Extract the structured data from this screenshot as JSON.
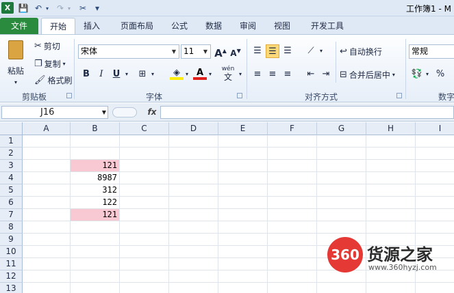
{
  "window": {
    "title": "工作簿1 - M"
  },
  "quick_access": {
    "app_icon": "X",
    "save": "💾",
    "undo": "↶",
    "redo": "↷",
    "tool": "✂",
    "more": "▾"
  },
  "tabs": [
    "文件",
    "开始",
    "插入",
    "页面布局",
    "公式",
    "数据",
    "审阅",
    "视图",
    "开发工具"
  ],
  "clipboard": {
    "paste": "粘贴",
    "cut": "剪切",
    "copy": "复制",
    "format_painter": "格式刷",
    "group": "剪贴板"
  },
  "font": {
    "name": "宋体",
    "size": "11",
    "grow": "A",
    "shrink": "A",
    "bold": "B",
    "italic": "I",
    "underline": "U",
    "wen": "wén",
    "group": "字体"
  },
  "alignment": {
    "wrap": "自动换行",
    "merge": "合并后居中",
    "group": "对齐方式"
  },
  "number": {
    "format": "常规",
    "percent": "%",
    "group": "数字"
  },
  "formula_bar": {
    "name_box": "J16",
    "fx": "fx",
    "content": ""
  },
  "sheet": {
    "columns": [
      "A",
      "B",
      "C",
      "D",
      "E",
      "F",
      "G",
      "H",
      "I"
    ],
    "rows": [
      "1",
      "2",
      "3",
      "4",
      "5",
      "6",
      "7",
      "8",
      "9",
      "10",
      "11",
      "12",
      "13"
    ],
    "cells": {
      "B3": "121",
      "B4": "8987",
      "B5": "312",
      "B6": "122",
      "B7": "121"
    },
    "highlight_color": "#f8c9d3",
    "highlighted": [
      "B3",
      "B7"
    ]
  },
  "watermark": {
    "badge": "360",
    "text": "货源之家",
    "url": "www.360hyzj.com"
  }
}
